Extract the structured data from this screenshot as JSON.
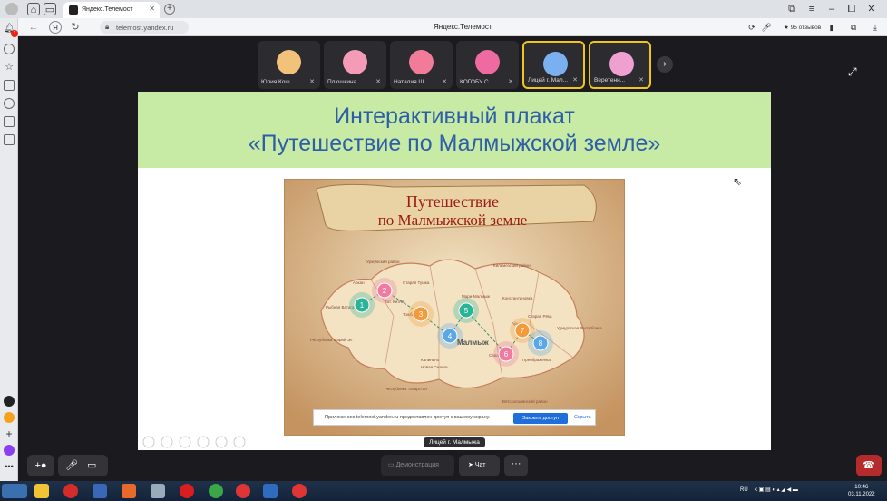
{
  "browser": {
    "tab_title": "Яндекс.Телемост",
    "url": "telemost.yandex.ru",
    "page_title": "Яндекс.Телемост",
    "reviews": "★ 95 отзывов",
    "badge": "1"
  },
  "participants": [
    {
      "name": "Юлия Кош...",
      "color": "#f2c27a",
      "active": false
    },
    {
      "name": "Плюшкина...",
      "color": "#f49bb8",
      "active": false
    },
    {
      "name": "Наталия Ш.",
      "color": "#f07c9a",
      "active": false
    },
    {
      "name": "КОГОБУ С...",
      "color": "#ee6aa0",
      "active": false
    },
    {
      "name": "Лицей г. Мал...",
      "color": "#7ab0ef",
      "active": true
    },
    {
      "name": "Веретенн...",
      "color": "#f0a0d0",
      "active": false
    }
  ],
  "slide": {
    "heading_line1": "Интерактивный плакат",
    "heading_line2": "«Путешествие по Малмыжской земле»",
    "poster_title_1": "Путешествие",
    "poster_title_2": "по Малмыжской земле",
    "map_labels": [
      "Уржумский район",
      "Кильмезский район",
      "Аркан",
      "Старая Тушка",
      "Рыбная Ватага",
      "Тат. Китня",
      "Тожба",
      "Калинино",
      "Константиновка",
      "Мари-Малмыж",
      "Малмыж",
      "Новая Смаиль",
      "Савали",
      "Арык",
      "Старая Рёка",
      "Преображенка",
      "Удмуртская Республика",
      "Республика Марий Эл",
      "Республика Татарстан",
      "Вятскополянский район"
    ],
    "map_city": "Малмыж",
    "map_points": [
      "1",
      "2",
      "3",
      "4",
      "5",
      "6",
      "7",
      "8"
    ],
    "share_notice": "Приложению telemost.yandex.ru предоставлен доступ к вашему экрану.",
    "share_accept": "Закрыть доступ",
    "share_hide": "Скрыть"
  },
  "speaker_label": "Лицей г. Малмыжа",
  "controls": {
    "demo": "Демонстрация",
    "chat": "Чат"
  },
  "taskbar": {
    "lang": "RU",
    "time": "10:46",
    "date": "03.11.2022"
  },
  "colors": {
    "slide_header_bg": "#c7eba4",
    "slide_title": "#2f5ea8",
    "end_call": "#b52a2a"
  }
}
